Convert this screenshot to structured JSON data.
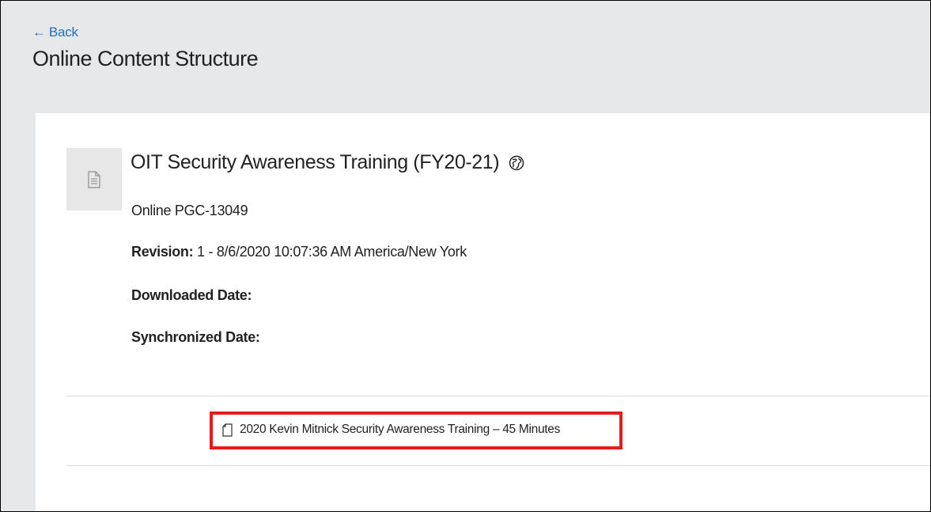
{
  "header": {
    "back_arrow": "←",
    "back_label": "Back",
    "title": "Online Content Structure"
  },
  "course": {
    "thumbnail_icon": "document-icon",
    "title": "OIT Security Awareness Training (FY20-21)",
    "status_icon": "globe-icon",
    "code": "Online PGC-13049",
    "revision_label": "Revision:",
    "revision_value": "1 - 8/6/2020 10:07:36 AM America/New York",
    "downloaded_label": "Downloaded Date:",
    "downloaded_value": "",
    "synchronized_label": "Synchronized Date:",
    "synchronized_value": ""
  },
  "modules": [
    {
      "icon": "file-icon",
      "label": "2020 Kevin Mitnick Security Awareness Training – 45 Minutes"
    }
  ],
  "colors": {
    "header_bg": "#e6e8e9",
    "link": "#1f6fc0",
    "highlight": "#e41c1c",
    "card_bg": "#ffffff"
  }
}
